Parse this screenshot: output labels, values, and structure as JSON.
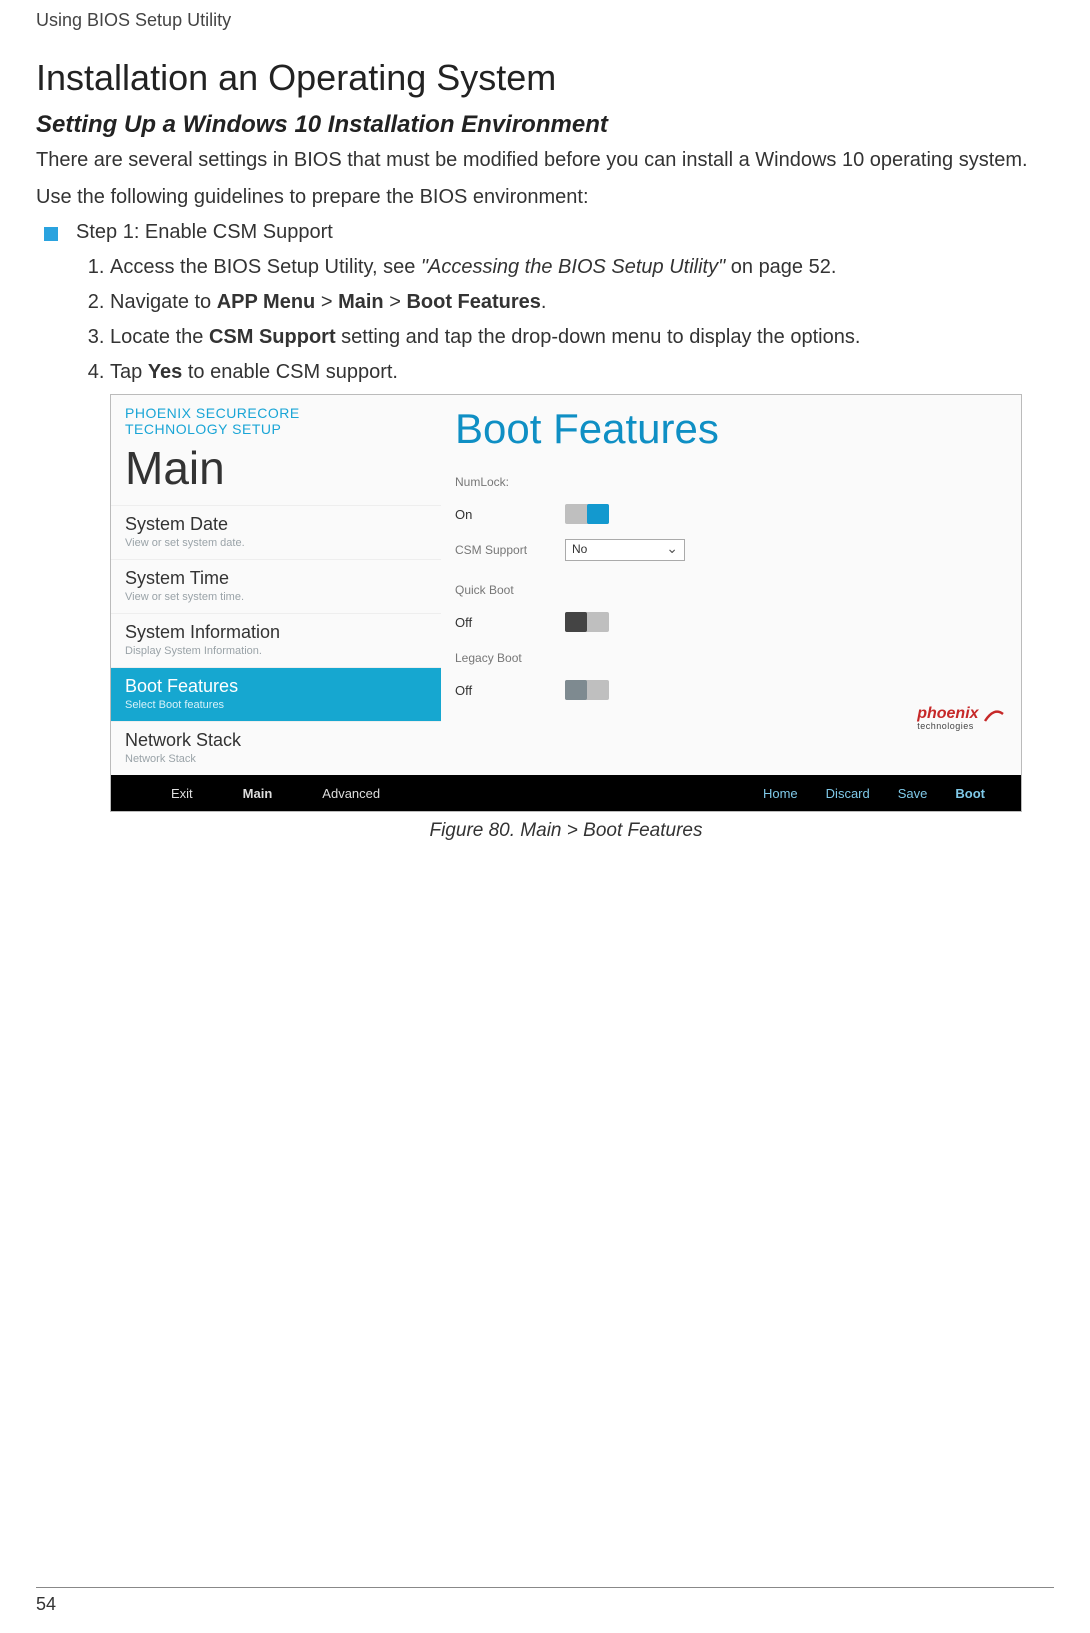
{
  "header": "Using BIOS Setup Utility",
  "title": "Installation an Operating System",
  "subtitle": "Setting Up a Windows 10 Installation Environment",
  "para1": "There are several settings in BIOS that must be modified before you can install a Windows 10 operating system.",
  "para2": "Use the following guidelines to prepare the BIOS environment:",
  "bullet": "Step 1: Enable CSM Support",
  "steps": {
    "s1a": "Access the BIOS Setup Utility, see ",
    "s1b": "\"Accessing the BIOS Setup Utility\"",
    "s1c": " on page 52.",
    "s2a": "Navigate to ",
    "s2b": "APP Menu",
    "s2c": " > ",
    "s2d": "Main",
    "s2e": " > ",
    "s2f": "Boot Features",
    "s2g": ".",
    "s3a": "Locate the ",
    "s3b": "CSM Support",
    "s3c": " setting and tap the drop-down menu to display the options.",
    "s4a": "Tap ",
    "s4b": "Yes",
    "s4c": " to enable CSM support."
  },
  "shot": {
    "brand1": "PHOENIX SECURECORE",
    "brand2": "TECHNOLOGY SETUP",
    "main": "Main",
    "nav": [
      {
        "title": "System Date",
        "sub": "View or set system date."
      },
      {
        "title": "System Time",
        "sub": "View or set system time."
      },
      {
        "title": "System Information",
        "sub": "Display System Information."
      },
      {
        "title": "Boot Features",
        "sub": "Select Boot features"
      },
      {
        "title": "Network Stack",
        "sub": "Network Stack"
      }
    ],
    "rightTitle": "Boot Features",
    "opts": {
      "numlock": "NumLock:",
      "numlock_val": "On",
      "csm": "CSM Support",
      "csm_val": "No",
      "quick": "Quick Boot",
      "quick_val": "Off",
      "legacy": "Legacy Boot",
      "legacy_val": "Off"
    },
    "logo": "phoenix",
    "logo_sub": "technologies",
    "bottom": {
      "exit": "Exit",
      "main": "Main",
      "adv": "Advanced",
      "home": "Home",
      "discard": "Discard",
      "save": "Save",
      "boot": "Boot"
    }
  },
  "caption": "Figure 80.  Main > Boot Features",
  "pagenum": "54"
}
